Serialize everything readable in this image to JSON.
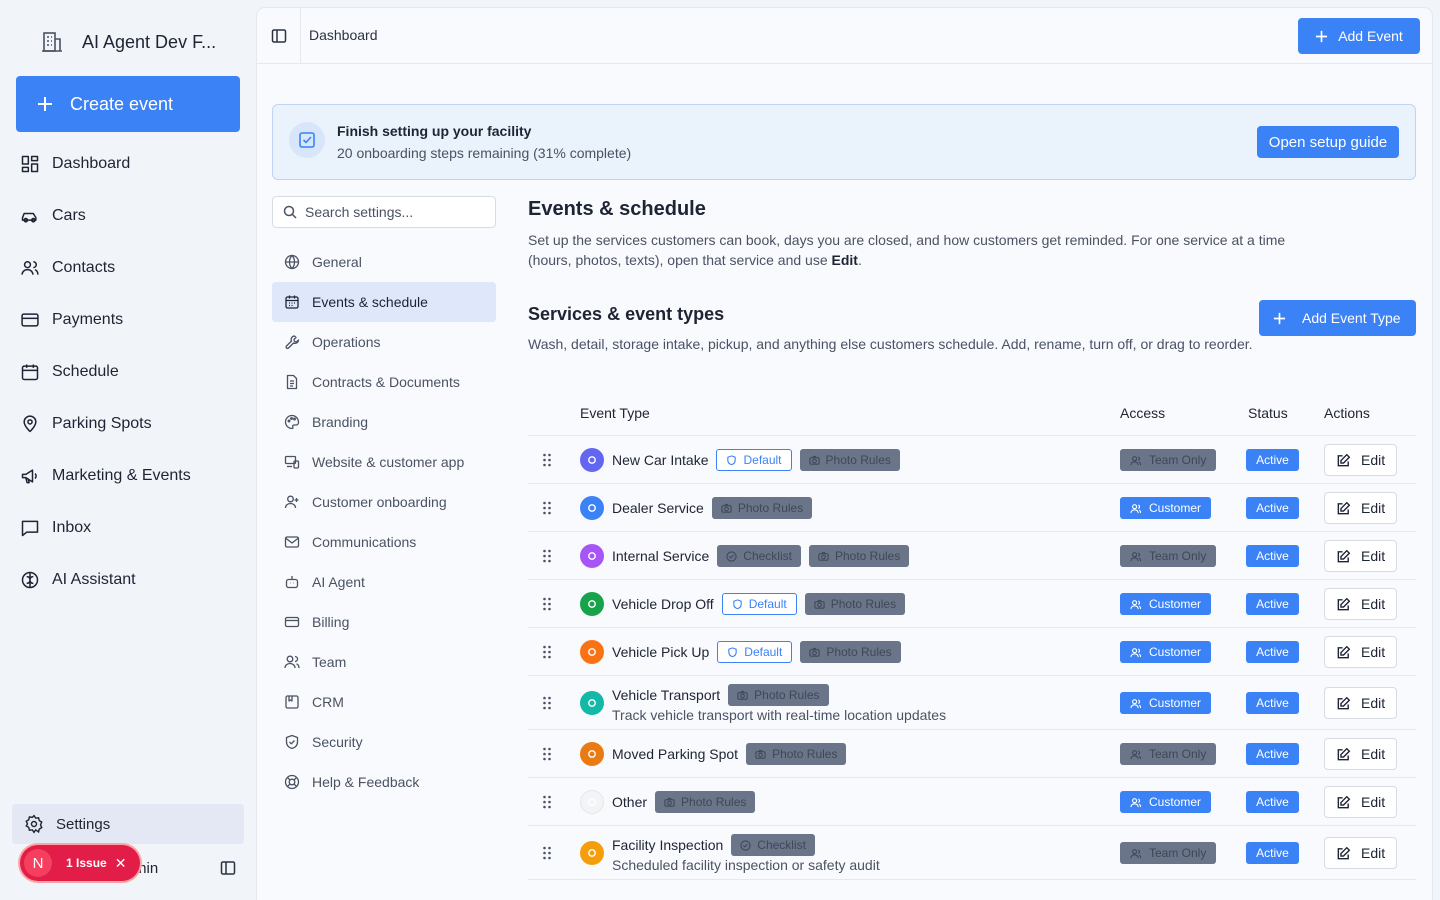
{
  "sidebar": {
    "brand": "AI Agent Dev F...",
    "create_label": "Create event",
    "items": [
      {
        "label": "Dashboard",
        "icon": "dashboard-icon"
      },
      {
        "label": "Cars",
        "icon": "car-icon"
      },
      {
        "label": "Contacts",
        "icon": "users-icon"
      },
      {
        "label": "Payments",
        "icon": "credit-card-icon"
      },
      {
        "label": "Schedule",
        "icon": "calendar-icon"
      },
      {
        "label": "Parking Spots",
        "icon": "map-pin-icon"
      },
      {
        "label": "Marketing & Events",
        "icon": "megaphone-icon"
      },
      {
        "label": "Inbox",
        "icon": "message-icon"
      },
      {
        "label": "AI Assistant",
        "icon": "brain-icon"
      }
    ],
    "settings_label": "Settings",
    "user_name": "min",
    "issue": {
      "avatar": "N",
      "label": "1 Issue"
    }
  },
  "topbar": {
    "breadcrumb": "Dashboard",
    "add_event_label": "Add Event"
  },
  "setup": {
    "title": "Finish setting up your facility",
    "subtitle": "20 onboarding steps remaining (31% complete)",
    "button": "Open setup guide"
  },
  "settings_nav": {
    "search_placeholder": "Search settings...",
    "items": [
      {
        "label": "General"
      },
      {
        "label": "Events & schedule",
        "active": true
      },
      {
        "label": "Operations"
      },
      {
        "label": "Contracts & Documents"
      },
      {
        "label": "Branding"
      },
      {
        "label": "Website & customer app"
      },
      {
        "label": "Customer onboarding"
      },
      {
        "label": "Communications"
      },
      {
        "label": "AI Agent"
      },
      {
        "label": "Billing"
      },
      {
        "label": "Team"
      },
      {
        "label": "CRM"
      },
      {
        "label": "Security"
      },
      {
        "label": "Help & Feedback"
      }
    ]
  },
  "content": {
    "title": "Events & schedule",
    "description": "Set up the services customers can book, days you are closed, and how customers get reminded. For one service at a time (hours, photos, texts), open that service and use",
    "description_bold": "Edit",
    "section_title": "Services & event types",
    "section_description": "Wash, detail, storage intake, pickup, and anything else customers schedule. Add, rename, turn off, or drag to reorder.",
    "add_type_label": "Add Event Type"
  },
  "table": {
    "headers": {
      "type": "Event Type",
      "access": "Access",
      "status": "Status",
      "actions": "Actions"
    },
    "edit_label": "Edit",
    "rows": [
      {
        "name": "New Car Intake",
        "color": "#6366f1",
        "badges": [
          {
            "label": "Default",
            "kind": "default"
          },
          {
            "label": "Photo Rules",
            "kind": "gray"
          }
        ],
        "access": "Team Only",
        "access_kind": "team",
        "status": "Active",
        "desc": ""
      },
      {
        "name": "Dealer Service",
        "color": "#3b82f6",
        "badges": [
          {
            "label": "Photo Rules",
            "kind": "gray"
          }
        ],
        "access": "Customer",
        "access_kind": "customer",
        "status": "Active",
        "desc": ""
      },
      {
        "name": "Internal Service",
        "color": "#a855f7",
        "badges": [
          {
            "label": "Checklist",
            "kind": "gray"
          },
          {
            "label": "Photo Rules",
            "kind": "gray"
          }
        ],
        "access": "Team Only",
        "access_kind": "team",
        "status": "Active",
        "desc": ""
      },
      {
        "name": "Vehicle Drop Off",
        "color": "#16a34a",
        "badges": [
          {
            "label": "Default",
            "kind": "default"
          },
          {
            "label": "Photo Rules",
            "kind": "gray"
          }
        ],
        "access": "Customer",
        "access_kind": "customer",
        "status": "Active",
        "desc": ""
      },
      {
        "name": "Vehicle Pick Up",
        "color": "#f97316",
        "badges": [
          {
            "label": "Default",
            "kind": "default"
          },
          {
            "label": "Photo Rules",
            "kind": "gray"
          }
        ],
        "access": "Customer",
        "access_kind": "customer",
        "status": "Active",
        "desc": ""
      },
      {
        "name": "Vehicle Transport",
        "color": "#14b8a6",
        "badges": [
          {
            "label": "Photo Rules",
            "kind": "gray"
          }
        ],
        "access": "Customer",
        "access_kind": "customer",
        "status": "Active",
        "desc": "Track vehicle transport with real-time location updates"
      },
      {
        "name": "Moved Parking Spot",
        "color": "#ea7a12",
        "badges": [
          {
            "label": "Photo Rules",
            "kind": "gray"
          }
        ],
        "access": "Team Only",
        "access_kind": "team",
        "status": "Active",
        "desc": ""
      },
      {
        "name": "Other",
        "color": "#f3f4f6",
        "badges": [
          {
            "label": "Photo Rules",
            "kind": "gray"
          }
        ],
        "access": "Customer",
        "access_kind": "customer",
        "status": "Active",
        "desc": ""
      },
      {
        "name": "Facility Inspection",
        "color": "#f59e0b",
        "badges": [
          {
            "label": "Checklist",
            "kind": "gray"
          }
        ],
        "access": "Team Only",
        "access_kind": "team",
        "status": "Active",
        "desc": "Scheduled facility inspection or safety audit"
      }
    ]
  },
  "colors": {
    "accent": "#3b82f6",
    "gray_badge": "#6b7589"
  }
}
